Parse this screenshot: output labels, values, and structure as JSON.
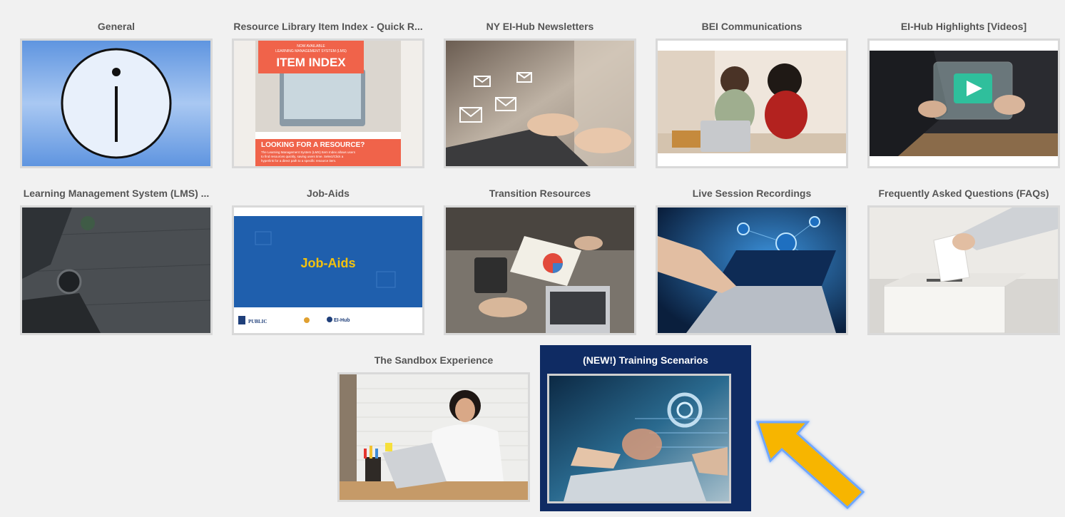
{
  "tiles": [
    {
      "title": "General",
      "icon": "info-icon"
    },
    {
      "title": "Resource Library Item Index - Quick R...",
      "image": {
        "line1": "NOW AVAILABLE",
        "line2": "LEARNING MANAGEMENT SYSTEM (LMS)",
        "heading": "ITEM INDEX",
        "banner": "LOOKING FOR A RESOURCE?",
        "body1": "The Learning Management System (LMS) Item Index allows users",
        "body2": "to find resources quickly, saving users time. Select/Click a",
        "body3": "hyperlink for a direct path to a specific resource item."
      }
    },
    {
      "title": "NY EI-Hub Newsletters",
      "image": "laptop-email-icons"
    },
    {
      "title": "BEI Communications",
      "image": "two-women-laptop"
    },
    {
      "title": "EI-Hub Highlights [Videos]",
      "image": "video-play-tablet"
    },
    {
      "title": "Learning Management System (LMS) ...",
      "image": "desk-laptop-coffee"
    },
    {
      "title": "Job-Aids",
      "image": {
        "heading": "Job-Aids",
        "logo1": "PUBLIC",
        "logo2": "EI-Hub"
      }
    },
    {
      "title": "Transition Resources",
      "image": "meeting-charts"
    },
    {
      "title": "Live Session Recordings",
      "image": "laptop-network"
    },
    {
      "title": "Frequently Asked Questions (FAQs)",
      "image": "ballot-box"
    },
    {
      "title": "The Sandbox Experience",
      "image": "woman-laptop-smiling"
    },
    {
      "title": "(NEW!) Training Scenarios",
      "image": "tech-hologram",
      "highlighted": true
    }
  ],
  "colors": {
    "background": "#f1f1f1",
    "title_text": "#555555",
    "highlight_bg": "#0f2b63",
    "arrow": "#f7b500",
    "item_index_orange": "#f0634a"
  }
}
